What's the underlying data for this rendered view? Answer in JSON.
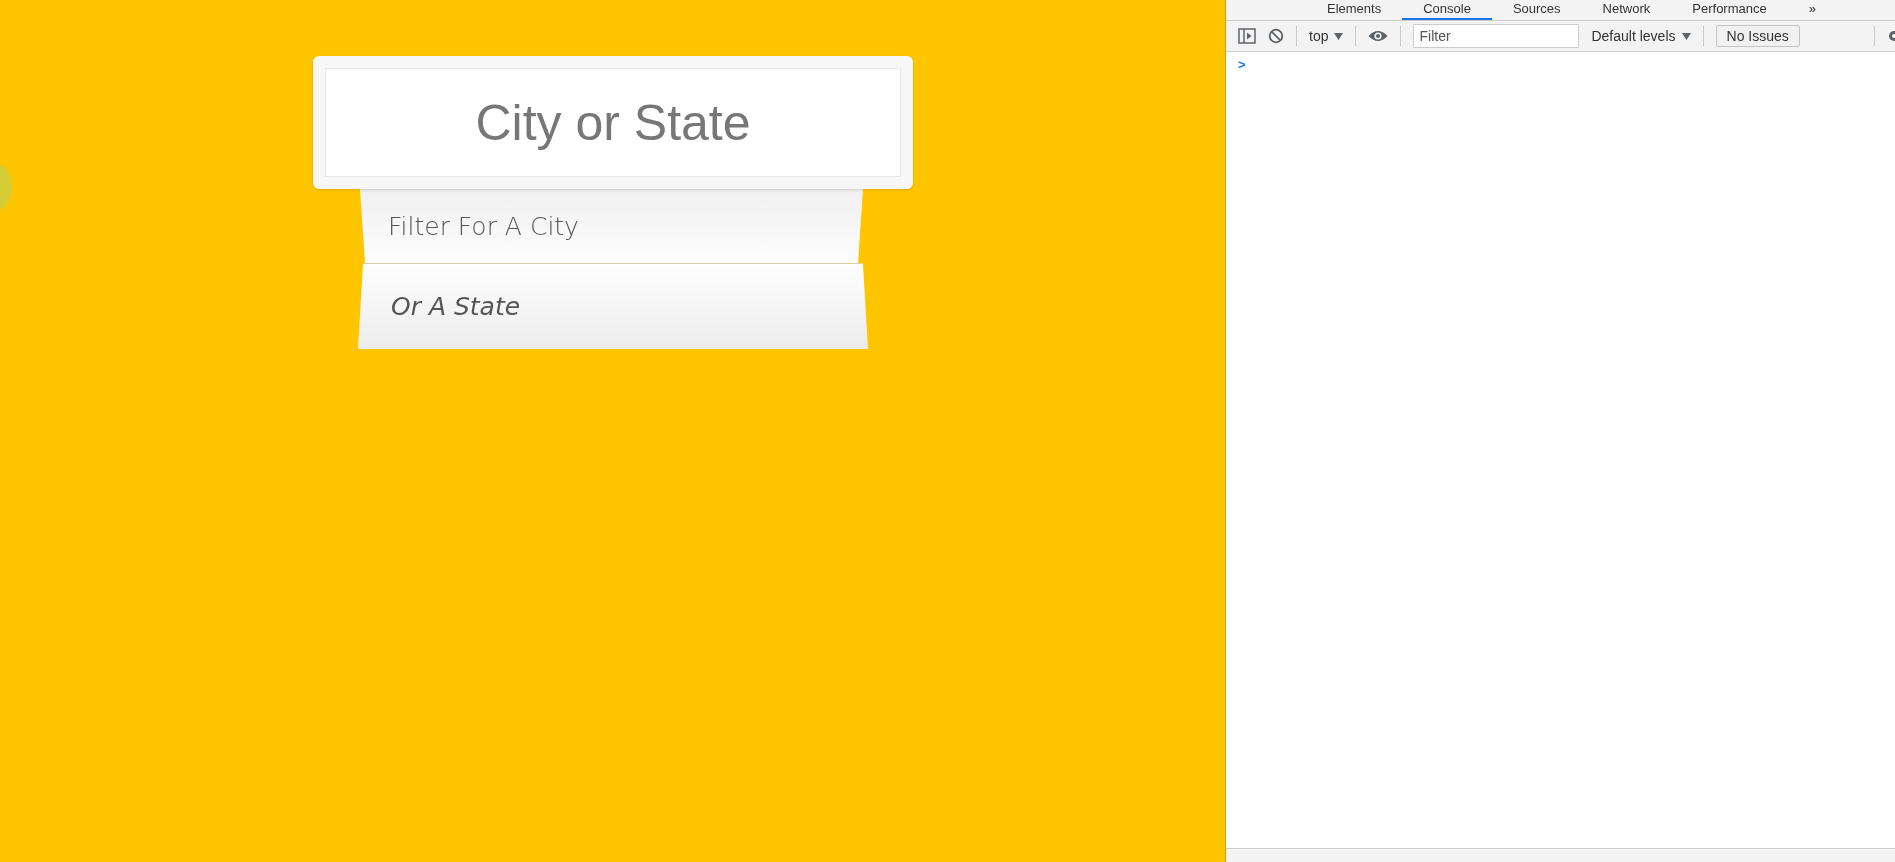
{
  "search": {
    "placeholder": "City or State"
  },
  "suggestions": [
    {
      "label": "Filter For A City",
      "hovered": false
    },
    {
      "label": "Or A State",
      "hovered": true
    }
  ],
  "devtools": {
    "tabs": [
      {
        "label": "Elements",
        "selected": false
      },
      {
        "label": "Console",
        "selected": true
      },
      {
        "label": "Sources",
        "selected": false
      },
      {
        "label": "Network",
        "selected": false
      },
      {
        "label": "Performance",
        "selected": false
      },
      {
        "label": "»",
        "selected": false
      }
    ],
    "context": "top",
    "filter": {
      "placeholder": "Filter"
    },
    "levels": "Default levels",
    "issues_button": "No Issues",
    "prompt": ">"
  }
}
